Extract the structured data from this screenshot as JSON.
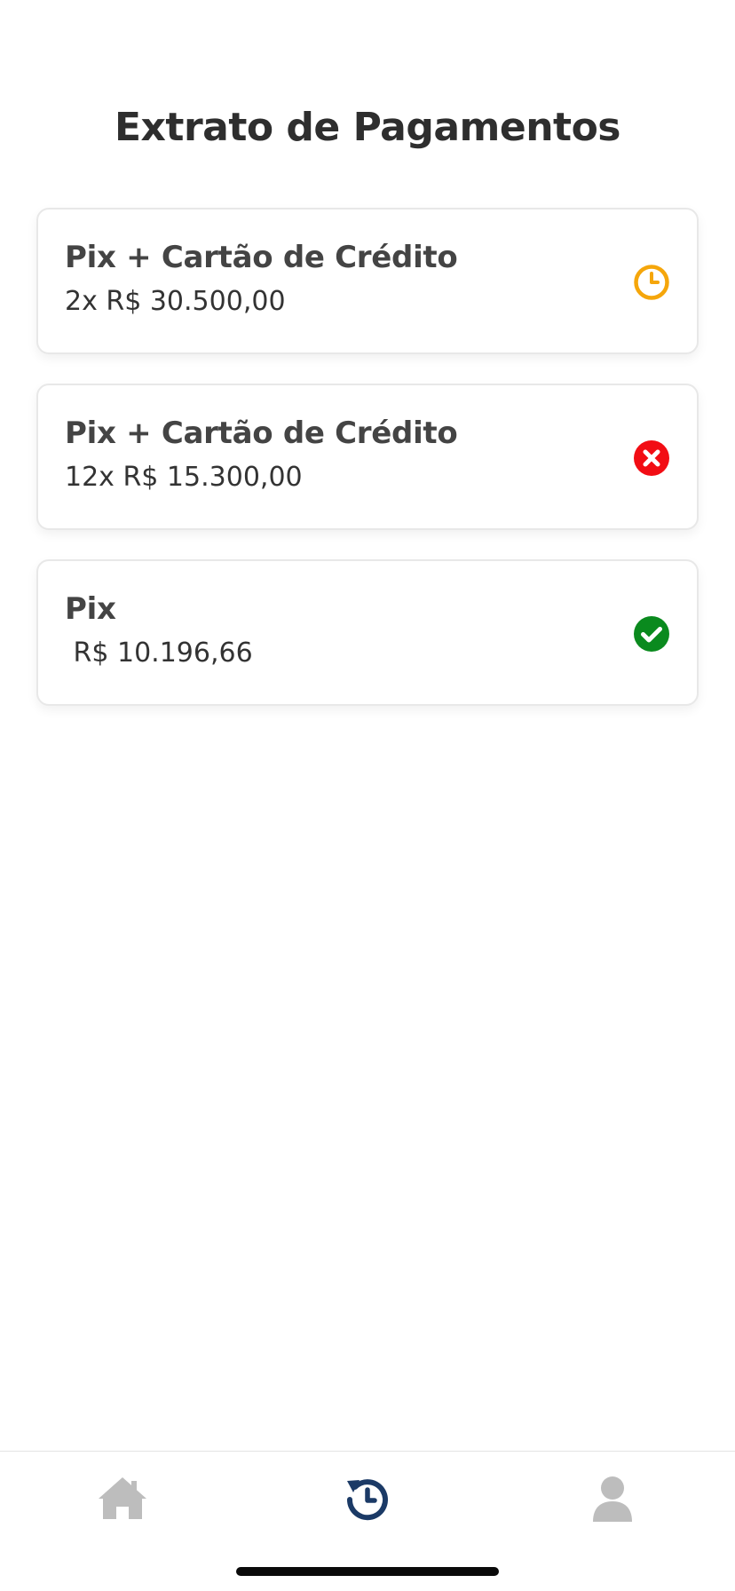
{
  "header": {
    "title": "Extrato de Pagamentos"
  },
  "payments": [
    {
      "method": "Pix + Cartão de Crédito",
      "amount": "2x R$ 30.500,00",
      "status": "pending",
      "status_icon": "clock-icon",
      "status_color": "#F5A60B"
    },
    {
      "method": "Pix + Cartão de Crédito",
      "amount": "12x R$ 15.300,00",
      "status": "failed",
      "status_icon": "x-circle-icon",
      "status_color": "#F20D14"
    },
    {
      "method": "Pix",
      "amount": " R$ 10.196,66",
      "status": "paid",
      "status_icon": "check-circle-icon",
      "status_color": "#0A8A1E"
    }
  ],
  "tabbar": {
    "items": [
      {
        "icon": "home-icon",
        "active": false,
        "color": "#BDBDBD"
      },
      {
        "icon": "history-icon",
        "active": true,
        "color": "#1B3A66"
      },
      {
        "icon": "user-icon",
        "active": false,
        "color": "#BDBDBD"
      }
    ]
  }
}
